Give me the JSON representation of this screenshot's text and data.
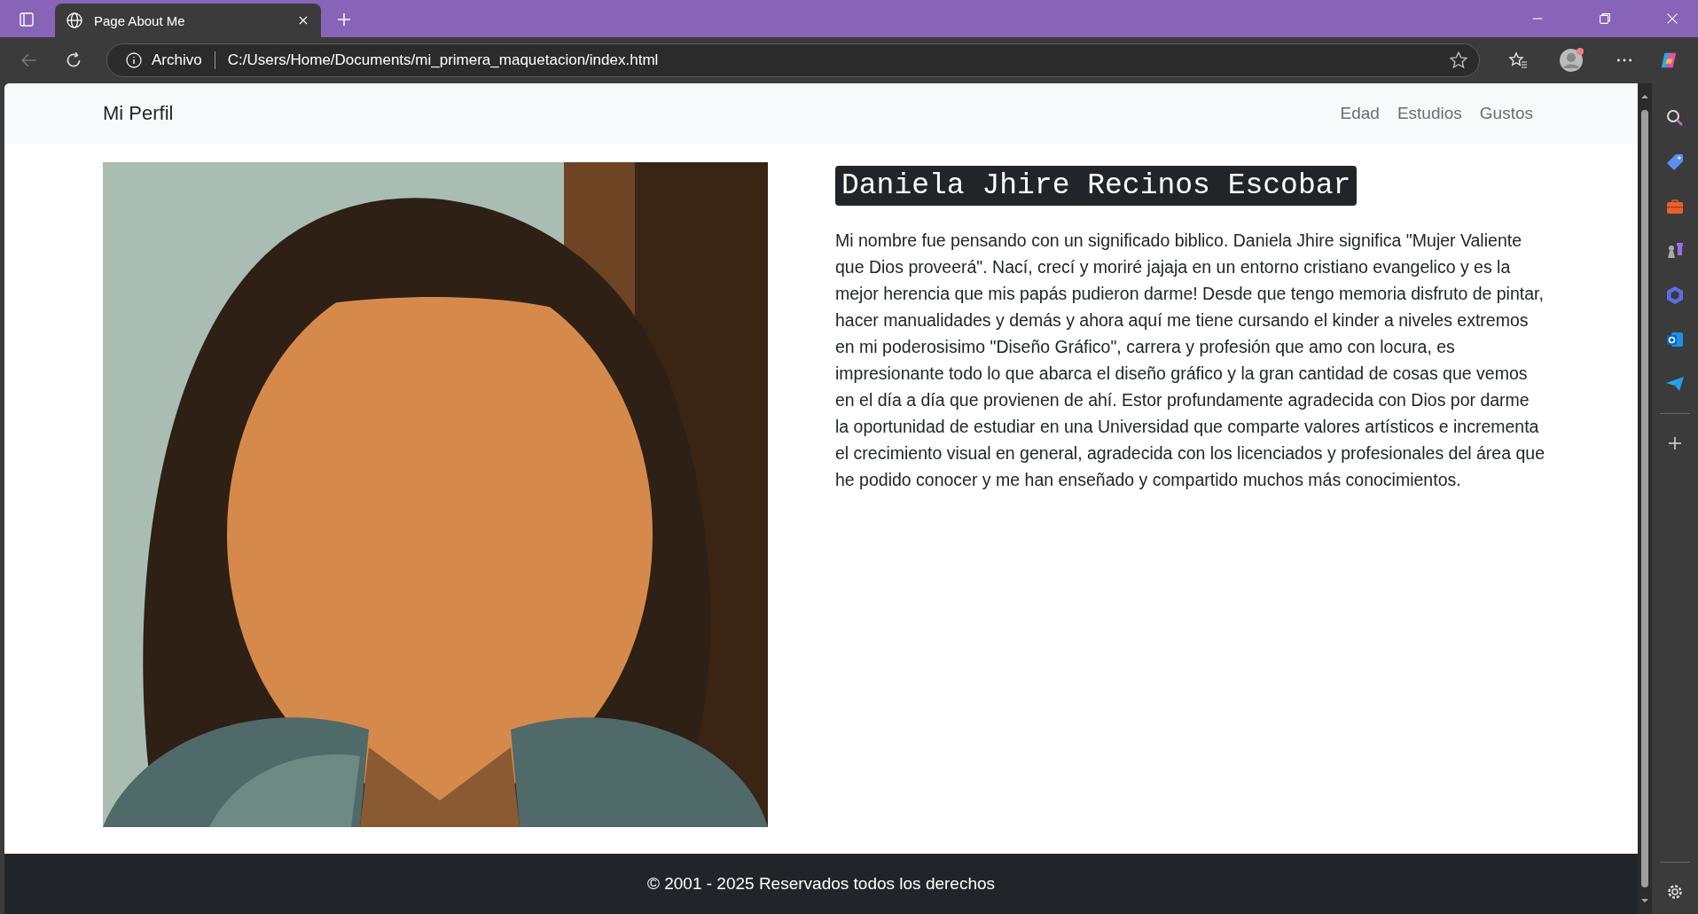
{
  "browser": {
    "tab_title": "Page About Me",
    "address_label": "Archivo",
    "url": "C:/Users/Home/Documents/mi_primera_maquetacion/index.html"
  },
  "navbar": {
    "brand": "Mi Perfil",
    "links": [
      "Edad",
      "Estudios",
      "Gustos"
    ]
  },
  "profile": {
    "name": "Daniela Jhire Recinos Escobar",
    "bio": "Mi nombre fue pensando con un significado biblico. Daniela Jhire significa \"Mujer Valiente que Dios proveerá\". Nací, crecí y moriré jajaja en un entorno cristiano evangelico y es la mejor herencia que mis papás pudieron darme! Desde que tengo memoria disfruto de pintar, hacer manualidades y demás y ahora aquí me tiene cursando el kinder a niveles extremos en mi poderosisimo \"Diseño Gráfico\", carrera y profesión que amo con locura, es impresionante todo lo que abarca el diseño gráfico y la gran cantidad de cosas que vemos en el día a día que provienen de ahí. Estor profundamente agradecida con Dios por darme la oportunidad de estudiar en una Universidad que comparte valores artísticos e incrementa el crecimiento visual en general, agradecida con los licenciados y profesionales del área que he podido conocer y me han enseñado y compartido muchos más conocimientos."
  },
  "footer": {
    "text": "© 2001 - 2025 Reservados todos los derechos"
  }
}
